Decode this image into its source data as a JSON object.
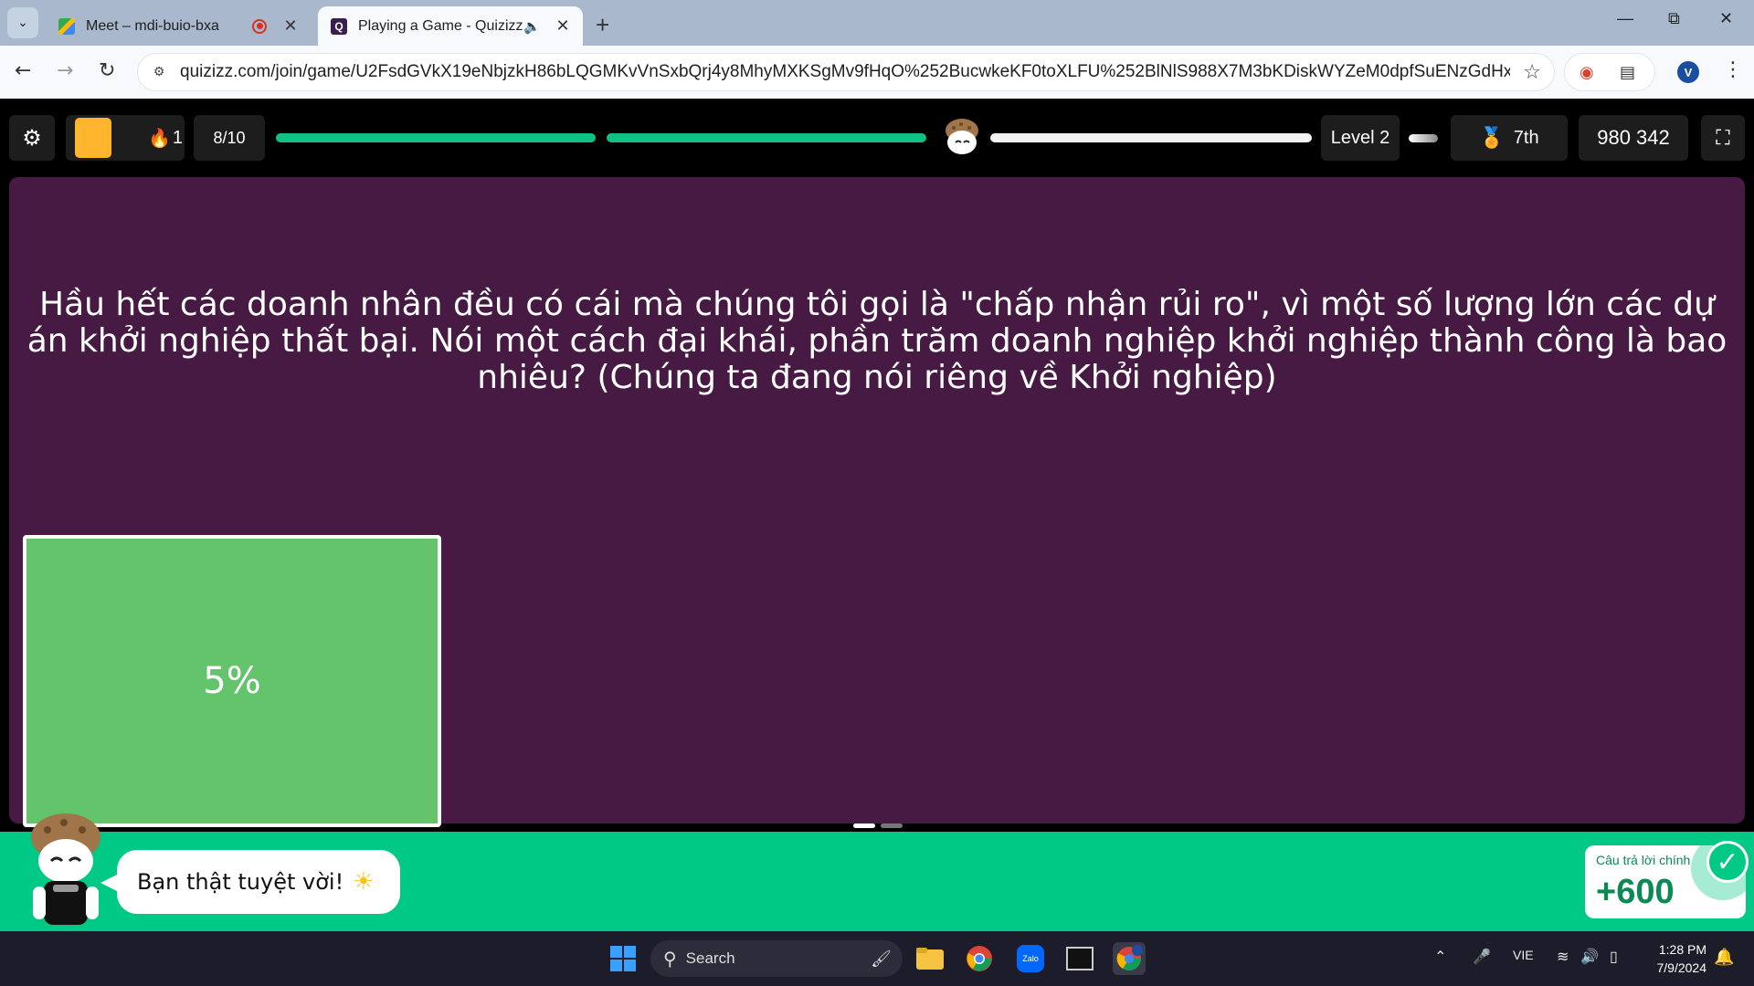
{
  "browser": {
    "tabs": [
      {
        "title": "Meet – mdi-buio-bxa",
        "active": false,
        "recording": true
      },
      {
        "title": "Playing a Game - Quizizz",
        "active": true,
        "audio": true
      }
    ],
    "url": "quizizz.com/join/game/U2FsdGVkX19eNbjzkH86bLQGMKvVnSxbQrj4y8MhyMXKSgMv9fHqO%252BucwkeKF0toXLFU%252BlNlS988X7M3bKDiskWYZeM0dpfSuENzGdHxJl0%253D?gameTy...",
    "profile_initial": "V"
  },
  "hud": {
    "streak": "1",
    "question_progress": "8/10",
    "level": "Level 2",
    "rank": "7th",
    "score": "980 342",
    "progress_fraction": 0.8
  },
  "question": {
    "text": "Hầu hết các doanh nhân đều có cái mà chúng tôi gọi là \"chấp nhận rủi ro\", vì một số lượng lớn các dự án khởi nghiệp thất bại. Nói một cách đại khái, phần trăm doanh nghiệp khởi nghiệp thành công là bao nhiêu? (Chúng ta đang nói riêng về Khởi nghiệp)"
  },
  "answer": {
    "label": "5%"
  },
  "feedback": {
    "message": "Bạn thật tuyệt vời!",
    "points_label": "Câu trả lời chính",
    "points_value": "+600"
  },
  "taskbar": {
    "search_placeholder": "Search",
    "language": "VIE",
    "time": "1:28 PM",
    "date": "7/9/2024"
  },
  "colors": {
    "panel": "#461a43",
    "answer": "#63c46c",
    "feedback_bar": "#00c985",
    "progress": "#0fc184"
  }
}
